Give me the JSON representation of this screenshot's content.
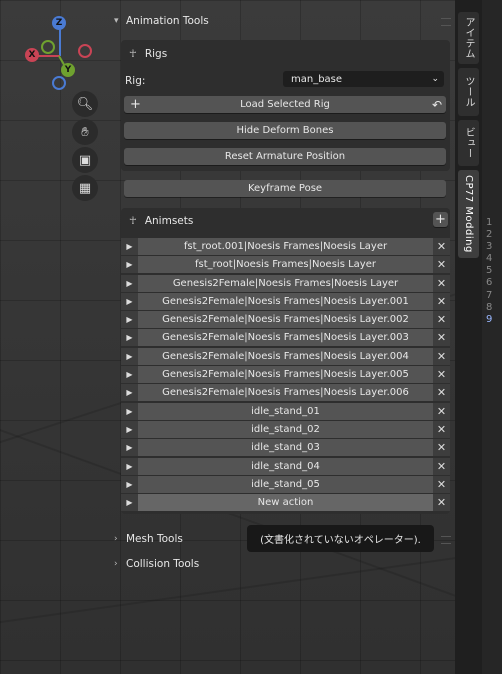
{
  "gizmo": {
    "z": "Z",
    "y": "Y",
    "x": "X"
  },
  "panel": {
    "animation_tools": "Animation Tools",
    "rigs_title": "Rigs",
    "rig_label": "Rig:",
    "rig_value": "man_base",
    "load_rig": "Load Selected Rig",
    "hide_bones": "Hide Deform Bones",
    "reset_armature": "Reset Armature Position",
    "keyframe_pose": "Keyframe Pose",
    "animsets_title": "Animsets",
    "animsets": [
      "fst_root.001|Noesis Frames|Noesis Layer",
      "fst_root|Noesis Frames|Noesis Layer",
      "Genesis2Female|Noesis Frames|Noesis Layer",
      "Genesis2Female|Noesis Frames|Noesis Layer.001",
      "Genesis2Female|Noesis Frames|Noesis Layer.002",
      "Genesis2Female|Noesis Frames|Noesis Layer.003",
      "Genesis2Female|Noesis Frames|Noesis Layer.004",
      "Genesis2Female|Noesis Frames|Noesis Layer.005",
      "Genesis2Female|Noesis Frames|Noesis Layer.006",
      "idle_stand_01",
      "idle_stand_02",
      "idle_stand_03",
      "idle_stand_04",
      "idle_stand_05",
      "New action"
    ],
    "mesh_tools": "Mesh Tools",
    "collision_tools": "Collision Tools"
  },
  "tooltip": "(文書化されていないオペレーター).",
  "tabs": [
    "アイテム",
    "ツール",
    "ビュー",
    "CP77 Modding"
  ],
  "line_numbers": [
    "1",
    "2",
    "3",
    "4",
    "5",
    "6",
    "7",
    "8",
    "9"
  ]
}
